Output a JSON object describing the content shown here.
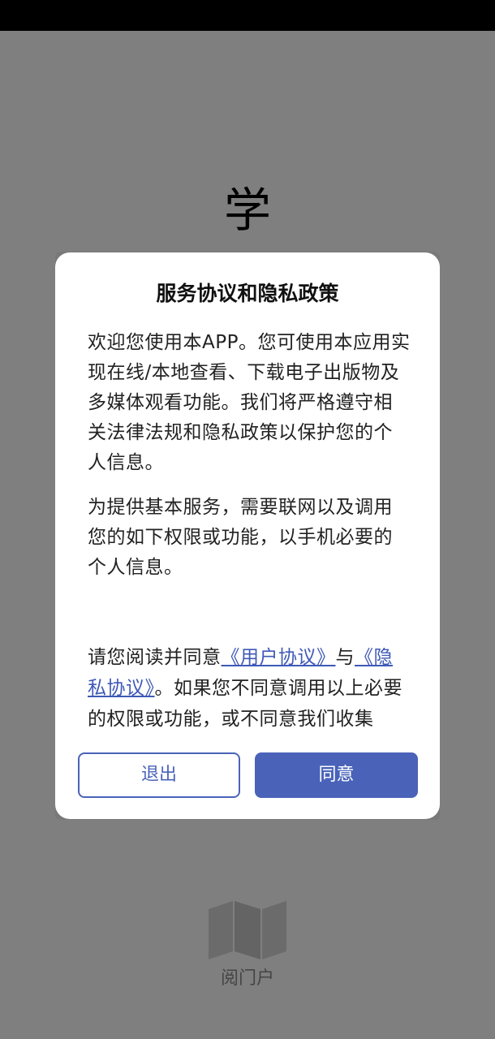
{
  "splash": {
    "char": "学",
    "brand_name": "阅门户",
    "logo_icon": "folded-map-icon"
  },
  "dialog": {
    "title": "服务协议和隐私政策",
    "paragraphs": [
      "欢迎您使用本APP。您可使用本应用实现在线/本地查看、下载电子出版物及多媒体观看功能。我们将严格遵守相关法律法规和隐私政策以保护您的个人信息。",
      "为提供基本服务，需要联网以及调用您的如下权限或功能，以手机必要的个人信息。"
    ],
    "consent": {
      "prefix": "请您阅读并同意",
      "user_agreement": "《用户协议》",
      "connector": "与",
      "privacy_agreement": "《隐私协议》",
      "suffix": "。如果您不同意调用以上必要的权限或功能，或不同意我们收集"
    },
    "buttons": {
      "exit": "退出",
      "agree": "同意"
    }
  },
  "colors": {
    "accent": "#4a63b9",
    "link": "#3f59b7",
    "overlay": "rgba(0,0,0,0.5)"
  }
}
